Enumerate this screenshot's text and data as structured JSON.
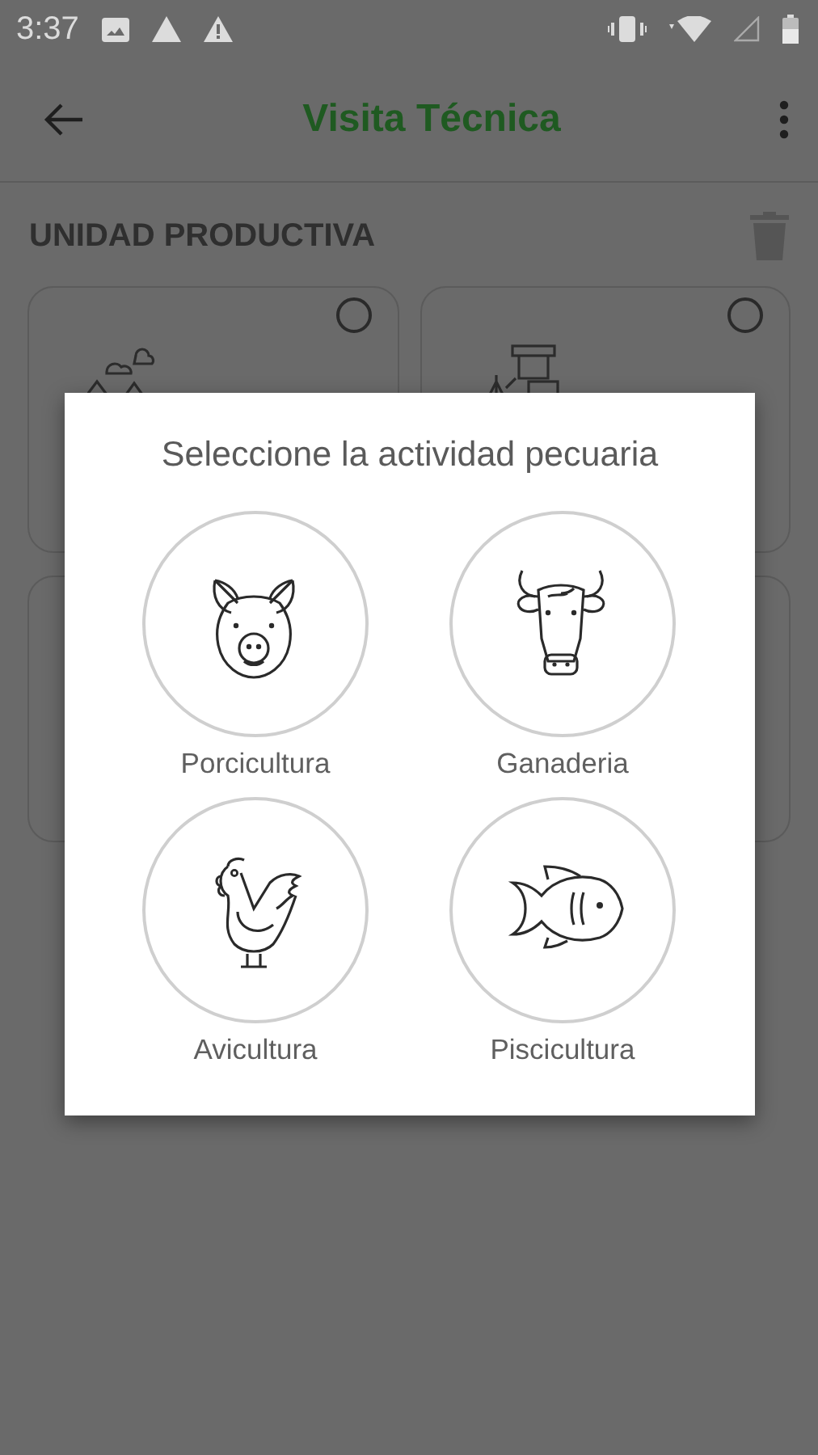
{
  "status_bar": {
    "time": "3:37"
  },
  "app_bar": {
    "title": "Visita Técnica"
  },
  "section": {
    "title": "UNIDAD PRODUCTIVA"
  },
  "cards": [
    {
      "kind": "landscape",
      "selected": false
    },
    {
      "kind": "tractor",
      "selected": false
    },
    {
      "kind": "blank"
    },
    {
      "kind": "blank"
    }
  ],
  "dialog": {
    "title": "Seleccione la actividad pecuaria",
    "options": [
      {
        "kind": "pig",
        "label": "Porcicultura"
      },
      {
        "kind": "cow",
        "label": "Ganaderia"
      },
      {
        "kind": "rooster",
        "label": "Avicultura"
      },
      {
        "kind": "fish",
        "label": "Piscicultura"
      }
    ]
  }
}
